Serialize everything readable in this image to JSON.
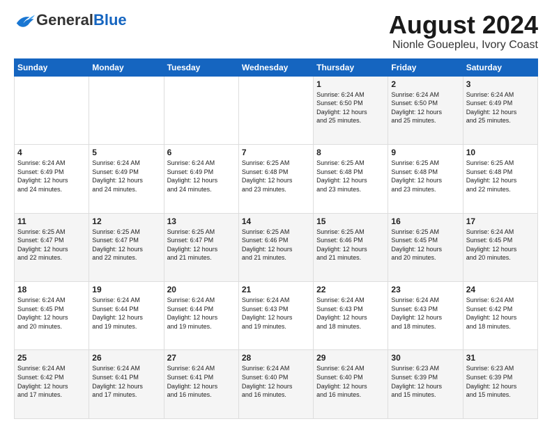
{
  "header": {
    "logo_general": "General",
    "logo_blue": "Blue",
    "title": "August 2024",
    "subtitle": "Nionle Gouepleu, Ivory Coast"
  },
  "calendar": {
    "days_of_week": [
      "Sunday",
      "Monday",
      "Tuesday",
      "Wednesday",
      "Thursday",
      "Friday",
      "Saturday"
    ],
    "weeks": [
      [
        {
          "day": "",
          "info": ""
        },
        {
          "day": "",
          "info": ""
        },
        {
          "day": "",
          "info": ""
        },
        {
          "day": "",
          "info": ""
        },
        {
          "day": "1",
          "info": "Sunrise: 6:24 AM\nSunset: 6:50 PM\nDaylight: 12 hours\nand 25 minutes."
        },
        {
          "day": "2",
          "info": "Sunrise: 6:24 AM\nSunset: 6:50 PM\nDaylight: 12 hours\nand 25 minutes."
        },
        {
          "day": "3",
          "info": "Sunrise: 6:24 AM\nSunset: 6:49 PM\nDaylight: 12 hours\nand 25 minutes."
        }
      ],
      [
        {
          "day": "4",
          "info": "Sunrise: 6:24 AM\nSunset: 6:49 PM\nDaylight: 12 hours\nand 24 minutes."
        },
        {
          "day": "5",
          "info": "Sunrise: 6:24 AM\nSunset: 6:49 PM\nDaylight: 12 hours\nand 24 minutes."
        },
        {
          "day": "6",
          "info": "Sunrise: 6:24 AM\nSunset: 6:49 PM\nDaylight: 12 hours\nand 24 minutes."
        },
        {
          "day": "7",
          "info": "Sunrise: 6:25 AM\nSunset: 6:48 PM\nDaylight: 12 hours\nand 23 minutes."
        },
        {
          "day": "8",
          "info": "Sunrise: 6:25 AM\nSunset: 6:48 PM\nDaylight: 12 hours\nand 23 minutes."
        },
        {
          "day": "9",
          "info": "Sunrise: 6:25 AM\nSunset: 6:48 PM\nDaylight: 12 hours\nand 23 minutes."
        },
        {
          "day": "10",
          "info": "Sunrise: 6:25 AM\nSunset: 6:48 PM\nDaylight: 12 hours\nand 22 minutes."
        }
      ],
      [
        {
          "day": "11",
          "info": "Sunrise: 6:25 AM\nSunset: 6:47 PM\nDaylight: 12 hours\nand 22 minutes."
        },
        {
          "day": "12",
          "info": "Sunrise: 6:25 AM\nSunset: 6:47 PM\nDaylight: 12 hours\nand 22 minutes."
        },
        {
          "day": "13",
          "info": "Sunrise: 6:25 AM\nSunset: 6:47 PM\nDaylight: 12 hours\nand 21 minutes."
        },
        {
          "day": "14",
          "info": "Sunrise: 6:25 AM\nSunset: 6:46 PM\nDaylight: 12 hours\nand 21 minutes."
        },
        {
          "day": "15",
          "info": "Sunrise: 6:25 AM\nSunset: 6:46 PM\nDaylight: 12 hours\nand 21 minutes."
        },
        {
          "day": "16",
          "info": "Sunrise: 6:25 AM\nSunset: 6:45 PM\nDaylight: 12 hours\nand 20 minutes."
        },
        {
          "day": "17",
          "info": "Sunrise: 6:24 AM\nSunset: 6:45 PM\nDaylight: 12 hours\nand 20 minutes."
        }
      ],
      [
        {
          "day": "18",
          "info": "Sunrise: 6:24 AM\nSunset: 6:45 PM\nDaylight: 12 hours\nand 20 minutes."
        },
        {
          "day": "19",
          "info": "Sunrise: 6:24 AM\nSunset: 6:44 PM\nDaylight: 12 hours\nand 19 minutes."
        },
        {
          "day": "20",
          "info": "Sunrise: 6:24 AM\nSunset: 6:44 PM\nDaylight: 12 hours\nand 19 minutes."
        },
        {
          "day": "21",
          "info": "Sunrise: 6:24 AM\nSunset: 6:43 PM\nDaylight: 12 hours\nand 19 minutes."
        },
        {
          "day": "22",
          "info": "Sunrise: 6:24 AM\nSunset: 6:43 PM\nDaylight: 12 hours\nand 18 minutes."
        },
        {
          "day": "23",
          "info": "Sunrise: 6:24 AM\nSunset: 6:43 PM\nDaylight: 12 hours\nand 18 minutes."
        },
        {
          "day": "24",
          "info": "Sunrise: 6:24 AM\nSunset: 6:42 PM\nDaylight: 12 hours\nand 18 minutes."
        }
      ],
      [
        {
          "day": "25",
          "info": "Sunrise: 6:24 AM\nSunset: 6:42 PM\nDaylight: 12 hours\nand 17 minutes."
        },
        {
          "day": "26",
          "info": "Sunrise: 6:24 AM\nSunset: 6:41 PM\nDaylight: 12 hours\nand 17 minutes."
        },
        {
          "day": "27",
          "info": "Sunrise: 6:24 AM\nSunset: 6:41 PM\nDaylight: 12 hours\nand 16 minutes."
        },
        {
          "day": "28",
          "info": "Sunrise: 6:24 AM\nSunset: 6:40 PM\nDaylight: 12 hours\nand 16 minutes."
        },
        {
          "day": "29",
          "info": "Sunrise: 6:24 AM\nSunset: 6:40 PM\nDaylight: 12 hours\nand 16 minutes."
        },
        {
          "day": "30",
          "info": "Sunrise: 6:23 AM\nSunset: 6:39 PM\nDaylight: 12 hours\nand 15 minutes."
        },
        {
          "day": "31",
          "info": "Sunrise: 6:23 AM\nSunset: 6:39 PM\nDaylight: 12 hours\nand 15 minutes."
        }
      ]
    ]
  }
}
